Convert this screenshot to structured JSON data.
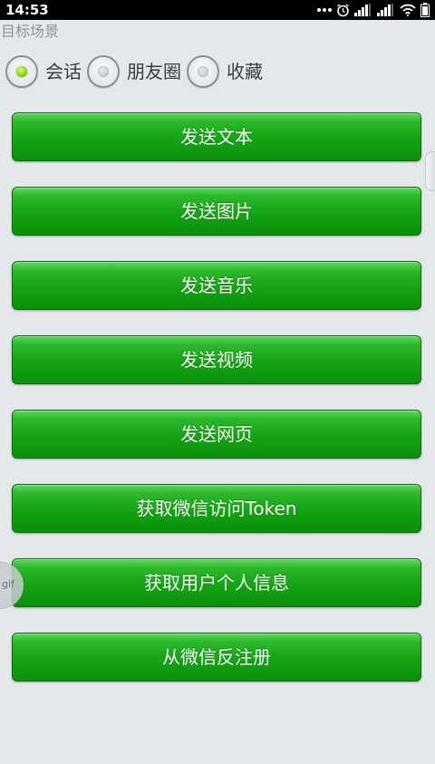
{
  "status_bar": {
    "time": "14:53",
    "icons": [
      "more-dots-icon",
      "alarm-icon",
      "signal-icon",
      "signal-icon",
      "wifi-icon",
      "battery-icon"
    ]
  },
  "scene": {
    "title": "目标场景",
    "options": [
      {
        "label": "会话",
        "selected": true
      },
      {
        "label": "朋友圈",
        "selected": false
      },
      {
        "label": "收藏",
        "selected": false
      }
    ]
  },
  "buttons": {
    "send_text": "发送文本",
    "send_image": "发送图片",
    "send_music": "发送音乐",
    "send_video": "发送视频",
    "send_webpage": "发送网页",
    "get_token": "获取微信访问Token",
    "get_user_info": "获取用户个人信息",
    "unregister": "从微信反注册"
  },
  "overlay": {
    "gif_label": "gif"
  },
  "colors": {
    "button_green": "#14a414",
    "radio_selected": "#88d814",
    "background": "#e4e8ea"
  }
}
